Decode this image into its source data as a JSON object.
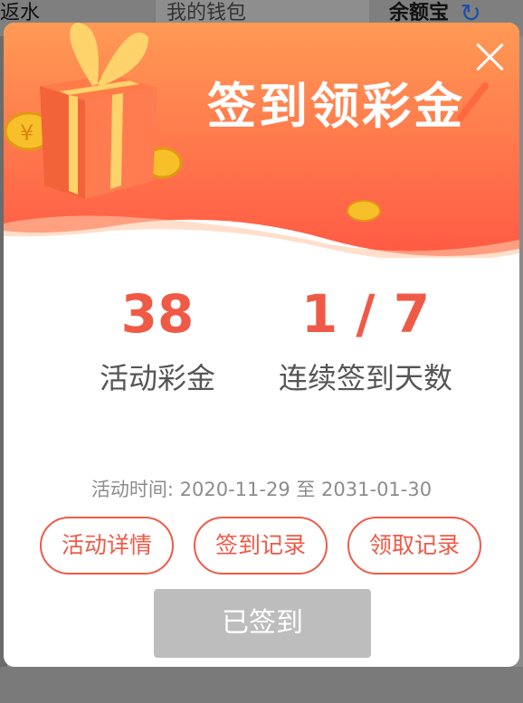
{
  "background": {
    "left_label": "返水",
    "wallet_label": "我的钱包",
    "right_label": "余额宝"
  },
  "modal": {
    "title": "签到领彩金",
    "amount": {
      "value": "38",
      "label": "活动彩金"
    },
    "days": {
      "value": "1 / 7",
      "label": "连续签到天数"
    },
    "period": "活动时间: 2020-11-29 至 2031-01-30",
    "buttons": {
      "details": "活动详情",
      "checkin_record": "签到记录",
      "claim_record": "领取记录"
    },
    "signed_button": "已签到"
  },
  "colors": {
    "accent": "#ef5a47",
    "header_top": "#ff8f4f",
    "header_bottom": "#ff5e45"
  }
}
